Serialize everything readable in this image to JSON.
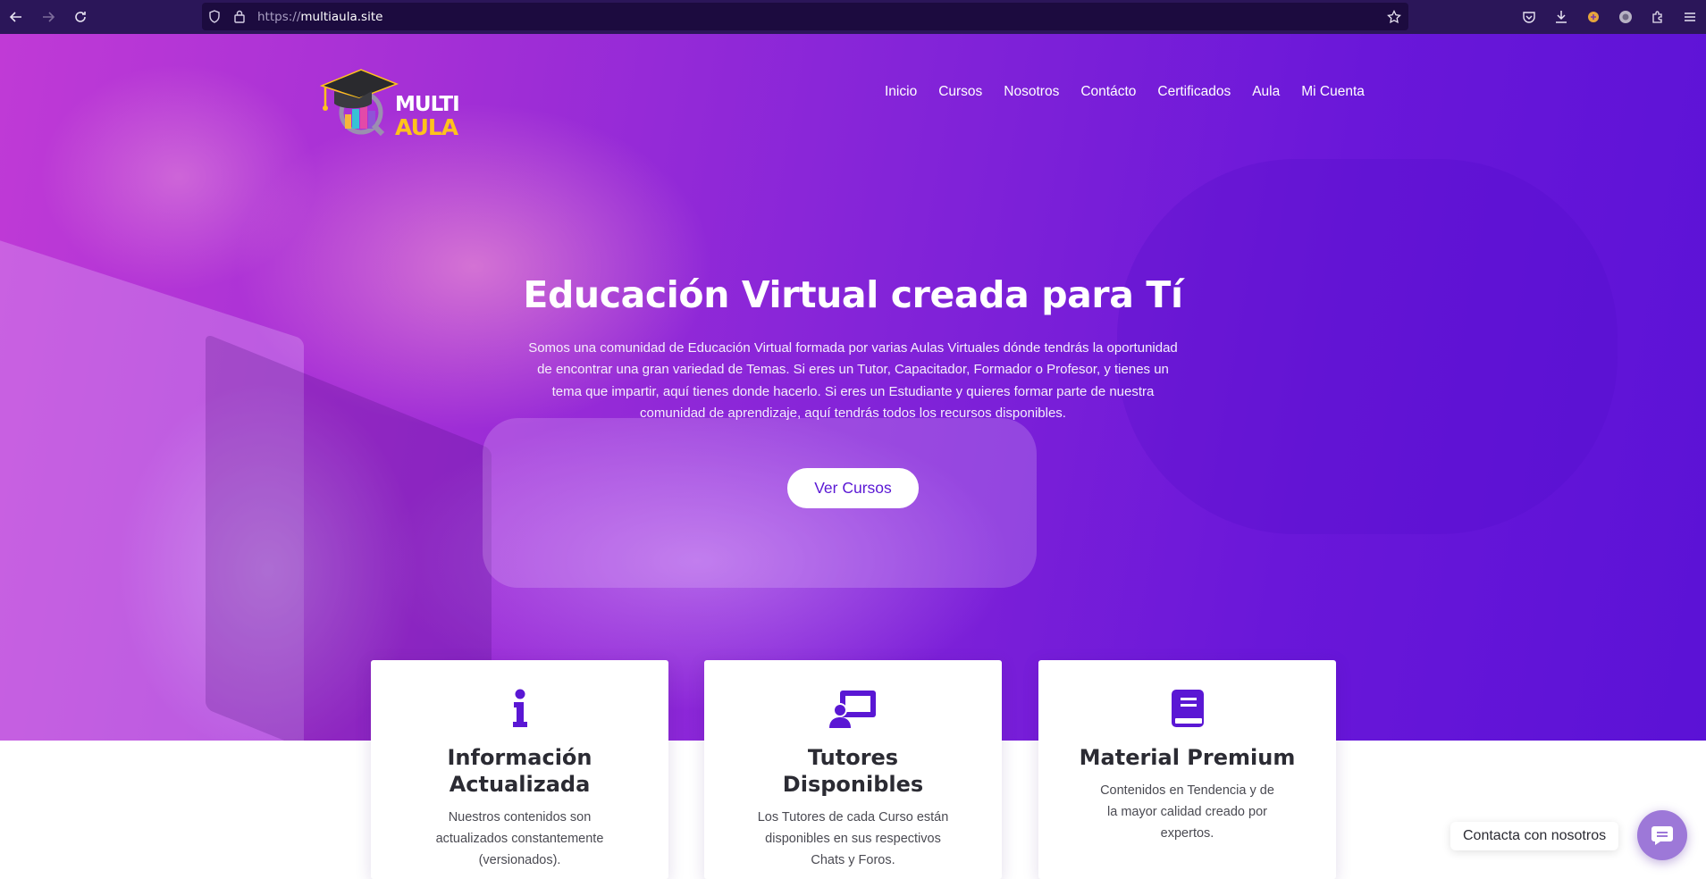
{
  "browser": {
    "url_protocol": "https://",
    "url_host": "multiaula.site",
    "icons": [
      "back-icon",
      "forward-icon",
      "reload-icon",
      "shield-icon",
      "lock-icon",
      "star-icon",
      "pocket-icon",
      "download-icon",
      "extension-icon",
      "profile-icon",
      "extensions-icon"
    ]
  },
  "brand": {
    "logo_line1": "MULTI",
    "logo_line2": "AULA",
    "accent_color": "#5a17d4",
    "logo_yellow": "#ffc21c"
  },
  "nav": {
    "items": [
      {
        "label": "Inicio"
      },
      {
        "label": "Cursos"
      },
      {
        "label": "Nosotros"
      },
      {
        "label": "Contácto"
      },
      {
        "label": "Certificados"
      },
      {
        "label": "Aula"
      },
      {
        "label": "Mi Cuenta"
      }
    ]
  },
  "hero": {
    "title": "Educación Virtual creada para Tí",
    "text": "Somos una comunidad de Educación Virtual formada por varias Aulas Virtuales dónde tendrás la oportunidad de encontrar una gran variedad de Temas. Si eres un Tutor, Capacitador, Formador o Profesor, y tienes un tema que impartir, aquí tienes donde hacerlo. Si eres un Estudiante y quieres formar parte de nuestra comunidad de aprendizaje, aquí tendrás todos los recursos disponibles.",
    "cta_label": "Ver Cursos"
  },
  "features": [
    {
      "icon": "info-icon",
      "title_line1": "Información",
      "title_line2": "Actualizada",
      "text": "Nuestros contenidos son actualizados constantemente (versionados)."
    },
    {
      "icon": "tutor-board-icon",
      "title_line1": "Tutores",
      "title_line2": "Disponibles",
      "text": "Los Tutores de cada Curso están disponibles en sus respectivos Chats y Foros."
    },
    {
      "icon": "book-icon",
      "title_line1": "Material Premium",
      "title_line2": "",
      "text": "Contenidos en Tendencia y de la mayor calidad creado por expertos."
    }
  ],
  "chat": {
    "label": "Contacta con nosotros",
    "icon": "chat-bubble-icon"
  }
}
